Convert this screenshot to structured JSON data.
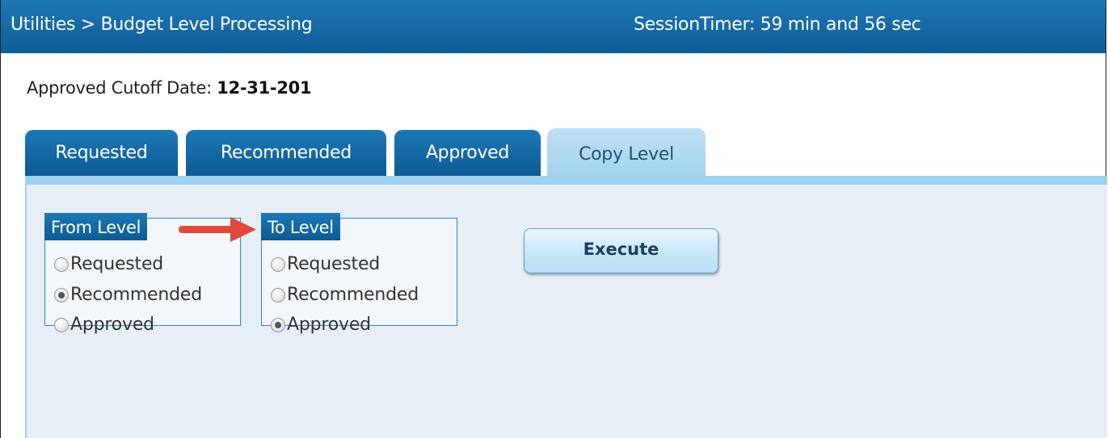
{
  "header": {
    "title": "Utilities > Budget Level Processing",
    "session_timer": "SessionTimer: 59 min and 56 sec"
  },
  "cutoff": {
    "label": "Approved Cutoff Date: ",
    "value": "12-31-201"
  },
  "tabs": [
    {
      "label": "Requested",
      "active": false
    },
    {
      "label": "Recommended",
      "active": false
    },
    {
      "label": "Approved",
      "active": false
    },
    {
      "label": "Copy Level",
      "active": true
    }
  ],
  "from_level": {
    "label": "From Level",
    "options": [
      "Requested",
      "Recommended",
      "Approved"
    ],
    "selected": "Recommended"
  },
  "to_level": {
    "label": "To Level",
    "options": [
      "Requested",
      "Recommended",
      "Approved"
    ],
    "selected": "Approved"
  },
  "execute": {
    "label": "Execute"
  },
  "colors": {
    "header_blue": "#0e5d97",
    "active_tab": "#9fd0ef",
    "panel_bg": "#e7eef6",
    "arrow": "#e0493c"
  }
}
